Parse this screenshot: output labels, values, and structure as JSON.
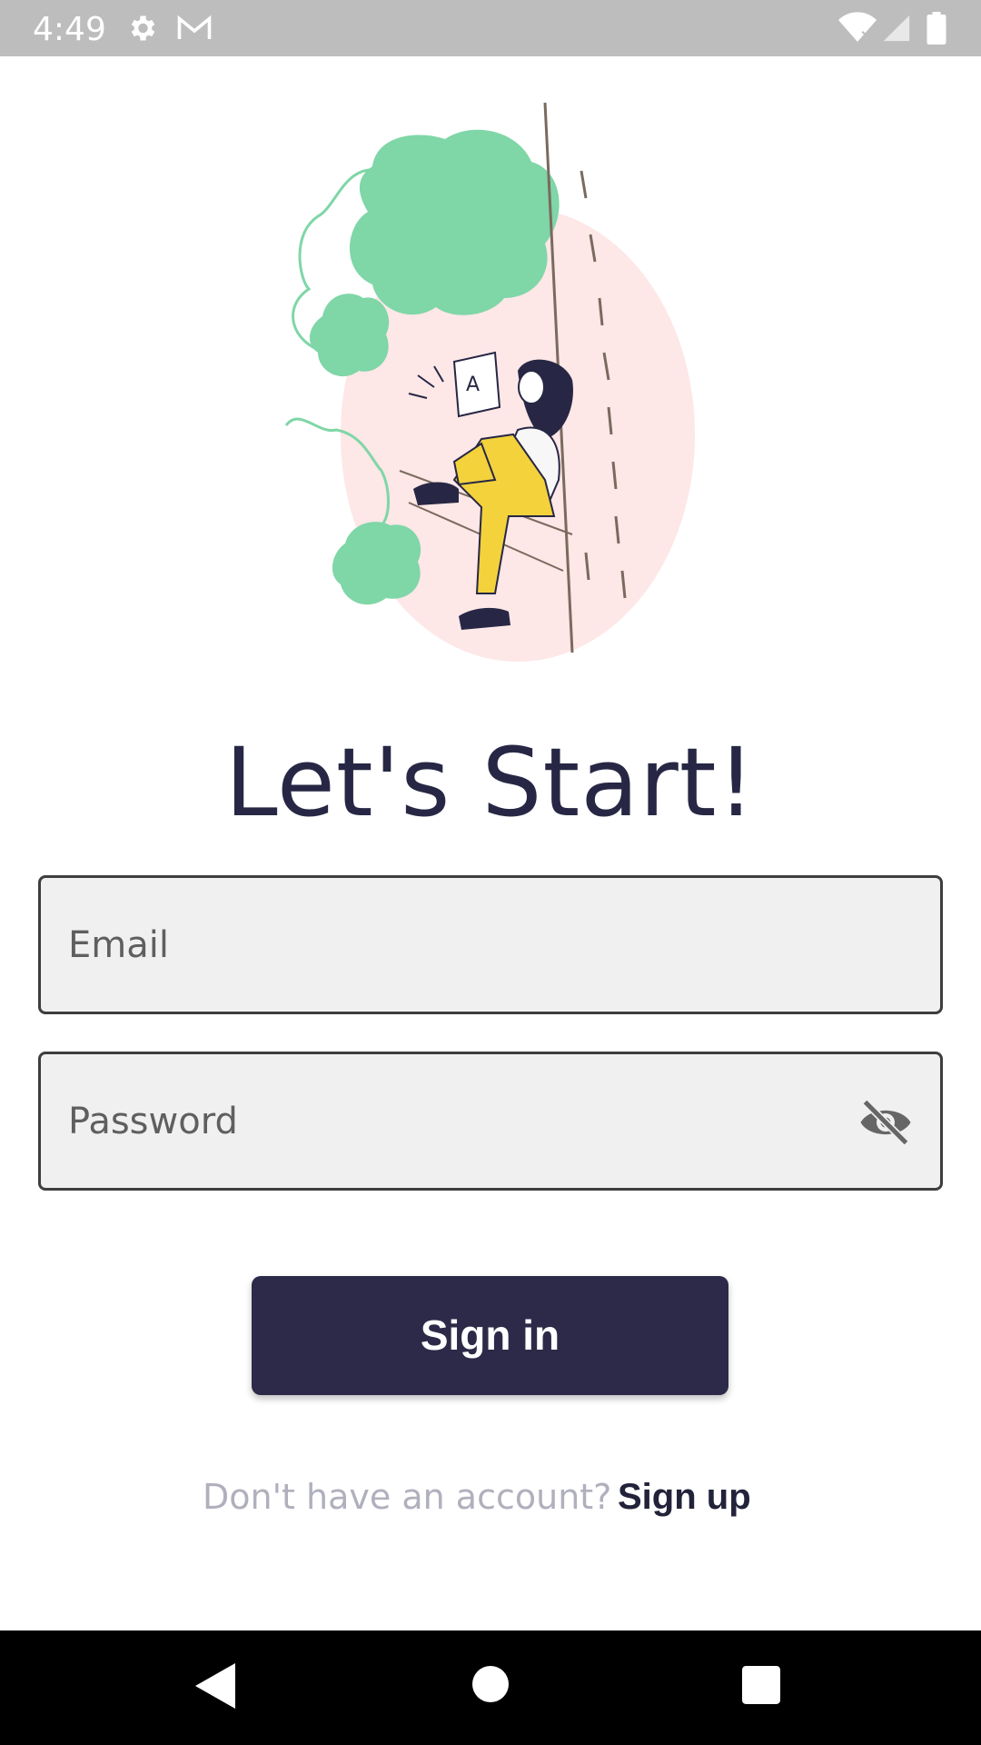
{
  "status_bar": {
    "time": "4:49",
    "icons": [
      "settings-icon",
      "gmail-icon",
      "wifi-icon",
      "signal-icon",
      "battery-icon"
    ]
  },
  "header": {
    "title": "Let's Start!"
  },
  "form": {
    "email": {
      "placeholder": "Email",
      "value": ""
    },
    "password": {
      "placeholder": "Password",
      "value": ""
    },
    "sign_in_label": "Sign in"
  },
  "footer": {
    "prompt": "Don't have an account?",
    "sign_up_label": "Sign up"
  },
  "nav_bar": {
    "buttons": [
      "back-icon",
      "home-icon",
      "recents-icon"
    ]
  },
  "colors": {
    "primary": "#2c2a48",
    "title": "#272745",
    "tree": "#7fd6a7",
    "blob": "#fde7e7",
    "pants": "#f3d23c"
  }
}
